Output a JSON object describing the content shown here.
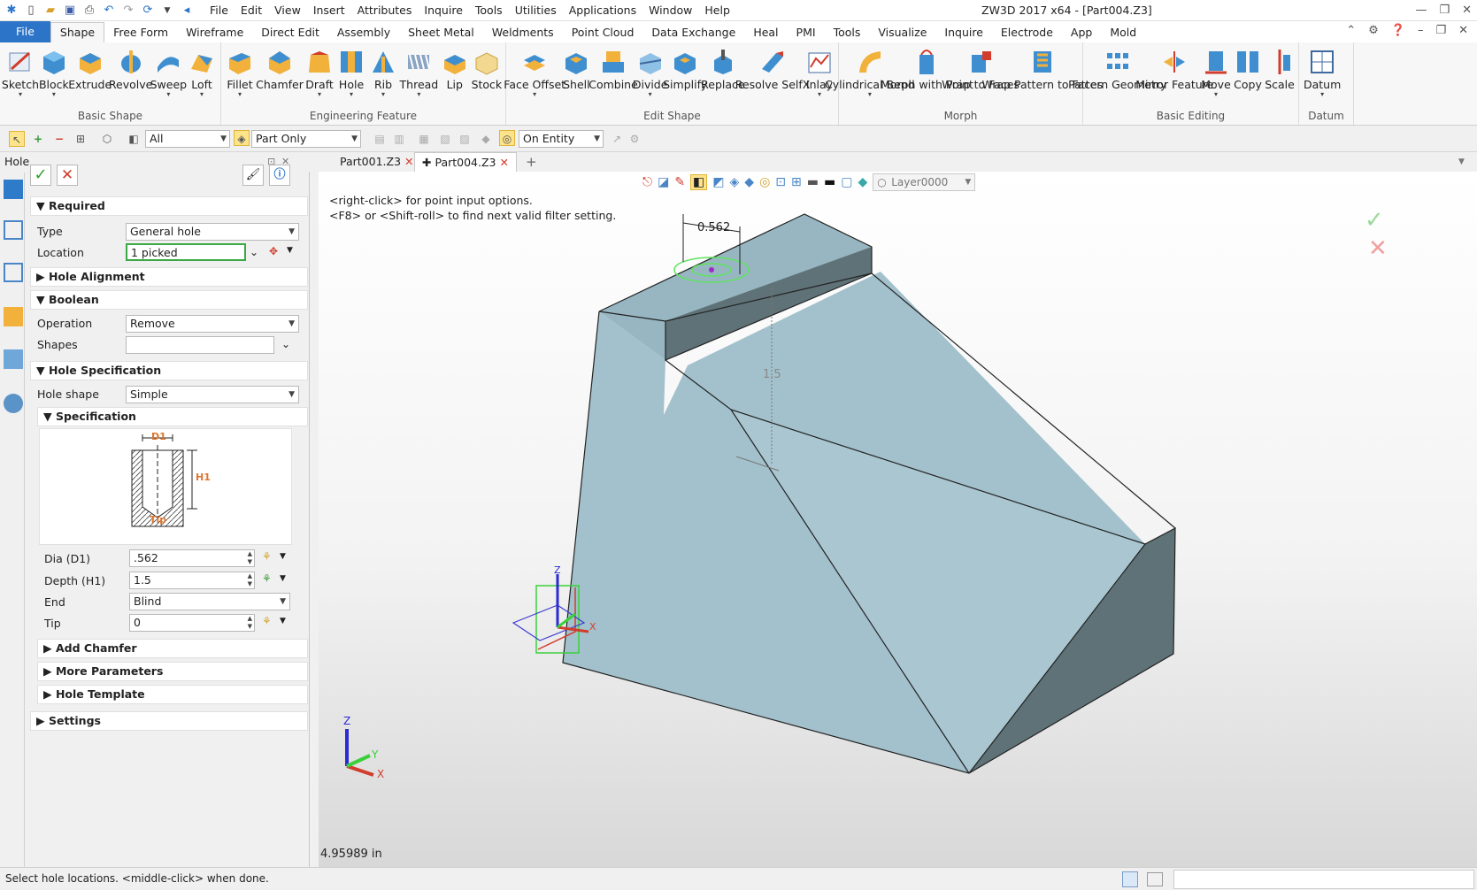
{
  "title_bar": {
    "menus": [
      "File",
      "Edit",
      "View",
      "Insert",
      "Attributes",
      "Inquire",
      "Tools",
      "Utilities",
      "Applications",
      "Window",
      "Help"
    ],
    "app_title": "ZW3D 2017  x64 - [Part004.Z3]"
  },
  "ribbon_tabs": [
    "File",
    "Shape",
    "Free Form",
    "Wireframe",
    "Direct Edit",
    "Assembly",
    "Sheet Metal",
    "Weldments",
    "Point Cloud",
    "Data Exchange",
    "Heal",
    "PMI",
    "Tools",
    "Visualize",
    "Inquire",
    "Electrode",
    "App",
    "Mold"
  ],
  "active_tab": "Shape",
  "ribbon_groups": [
    {
      "label": "Basic Shape",
      "buttons": [
        "Sketch",
        "Block",
        "Extrude",
        "Revolve",
        "Sweep",
        "Loft"
      ]
    },
    {
      "label": "Engineering Feature",
      "buttons": [
        "Fillet",
        "Chamfer",
        "Draft",
        "Hole",
        "Rib",
        "Thread",
        "Lip",
        "Stock"
      ]
    },
    {
      "label": "Edit Shape",
      "buttons": [
        "Face Offset",
        "Shell",
        "Combine",
        "Divide",
        "Simplify",
        "Replace",
        "Resolve SelfX",
        "Inlay"
      ]
    },
    {
      "label": "Morph",
      "buttons": [
        "Cylindrical Bend",
        "Morph with Point",
        "Wrap to Faces",
        "Wrap Pattern to Faces"
      ]
    },
    {
      "label": "Basic Editing",
      "buttons": [
        "Pattern Geometry",
        "Mirror Feature",
        "Move",
        "Copy",
        "Scale"
      ]
    },
    {
      "label": "Datum",
      "buttons": [
        "Datum"
      ]
    }
  ],
  "filter_bar": {
    "filter": "All",
    "scope": "Part Only",
    "pick": "On Entity"
  },
  "doc_tabs": [
    "Part001.Z3",
    "Part004.Z3"
  ],
  "active_doc": "Part004.Z3",
  "panel": {
    "title": "Hole",
    "required": "Required",
    "type_label": "Type",
    "type_value": "General hole",
    "location_label": "Location",
    "location_value": "1 picked",
    "hole_alignment": "Hole Alignment",
    "boolean": "Boolean",
    "operation_label": "Operation",
    "operation_value": "Remove",
    "shapes_label": "Shapes",
    "shapes_value": "",
    "hole_spec": "Hole Specification",
    "hole_shape_label": "Hole shape",
    "hole_shape_value": "Simple",
    "specification": "Specification",
    "diagram": {
      "d1": "D1",
      "h1": "H1",
      "tip": "Tip"
    },
    "dia_label": "Dia (D1)",
    "dia_value": ".562",
    "depth_label": "Depth (H1)",
    "depth_value": "1.5",
    "end_label": "End",
    "end_value": "Blind",
    "tip_label": "Tip",
    "tip_value": "0",
    "add_chamfer": "Add Chamfer",
    "more_params": "More Parameters",
    "hole_template": "Hole Template",
    "settings": "Settings"
  },
  "viewport": {
    "hint1": "<right-click> for point input options.",
    "hint2": "<F8> or <Shift-roll> to find next valid filter setting.",
    "dim_dia": "0.562",
    "dim_depth": "1.5",
    "layer": "Layer0000",
    "measure": "4.95989 in",
    "axis_x": "X",
    "axis_y": "Y",
    "axis_z": "Z"
  },
  "status": "Select hole locations. <middle-click> when done.",
  "colors": {
    "face_light": "#a9c6d1",
    "face_mid": "#93b4c0",
    "face_dark": "#5f7277",
    "accent": "#2b74c7"
  }
}
